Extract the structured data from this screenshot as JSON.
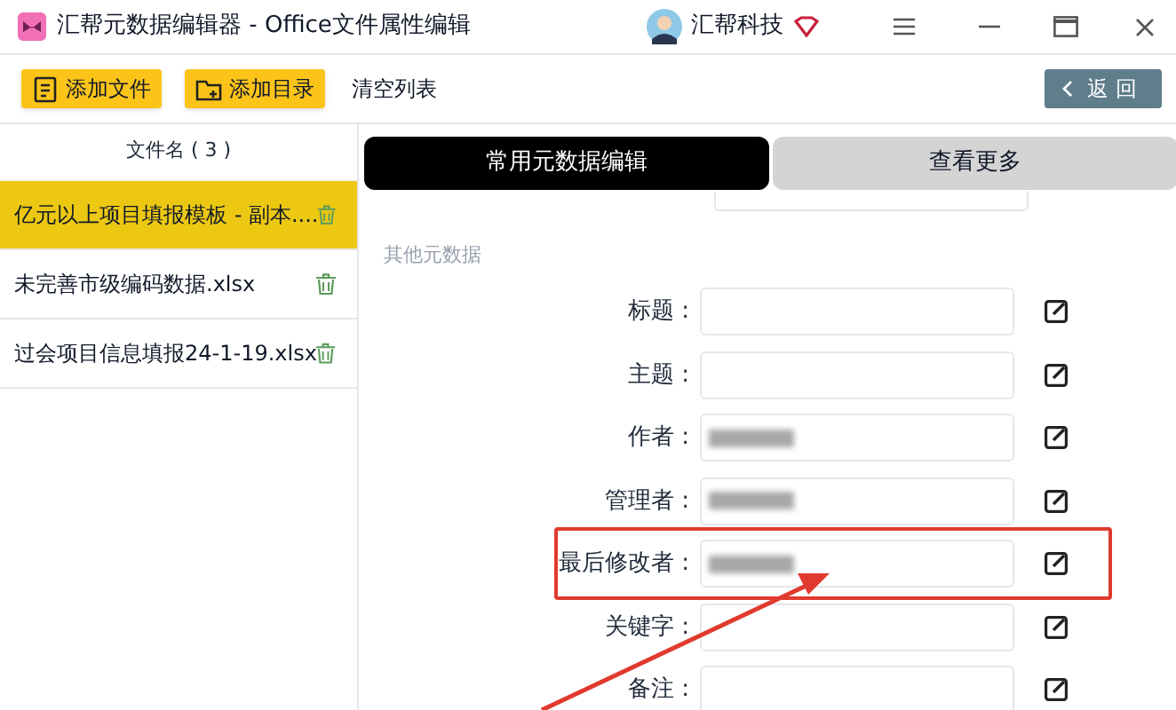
{
  "window": {
    "title": "汇帮元数据编辑器 - Office文件属性编辑",
    "user": "汇帮科技"
  },
  "toolbar": {
    "buttons": [
      {
        "label": "添加文件",
        "kind": "file"
      },
      {
        "label": "添加目录",
        "kind": "folder"
      }
    ],
    "clear": "清空列表",
    "back": "返回"
  },
  "file_list": {
    "header": "文件名 ( 3 )",
    "items": [
      {
        "name": "亿元以上项目填报模板 - 副本....",
        "selected": true
      },
      {
        "name": "未完善市级编码数据.xlsx",
        "selected": false
      },
      {
        "name": "过会项目信息填报24-1-19.xlsx",
        "selected": false
      }
    ]
  },
  "tabs": [
    {
      "label": "常用元数据编辑",
      "selected": true
    },
    {
      "label": "查看更多",
      "selected": false
    }
  ],
  "section": "其他元数据",
  "fields": [
    {
      "label": "标题 :",
      "redacted": false,
      "highlighted": false
    },
    {
      "label": "主题 :",
      "redacted": false,
      "highlighted": false
    },
    {
      "label": "作者 :",
      "redacted": true,
      "highlighted": false
    },
    {
      "label": "管理者 :",
      "redacted": true,
      "highlighted": false
    },
    {
      "label": "最后修改者 :",
      "redacted": true,
      "highlighted": true
    },
    {
      "label": "关键字 :",
      "redacted": false,
      "highlighted": false
    },
    {
      "label": "备注 :",
      "redacted": false,
      "highlighted": false
    }
  ]
}
